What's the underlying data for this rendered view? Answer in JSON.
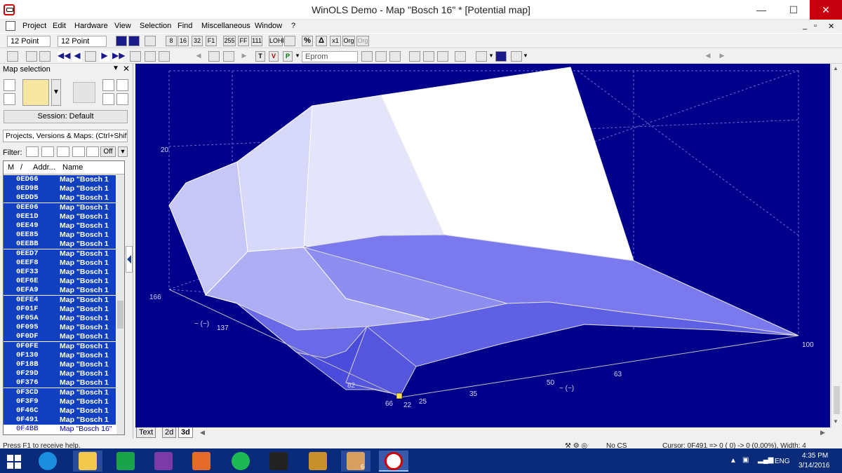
{
  "window": {
    "title": "WinOLS Demo - Map \"Bosch 16\" *   [Potential map]",
    "minimize": "—",
    "maximize": "☐",
    "close": "✕"
  },
  "menu": {
    "items": [
      "Project",
      "Edit",
      "Hardware",
      "View",
      "Selection",
      "Find",
      "Miscellaneous",
      "Window",
      "?"
    ],
    "right_controls": [
      "_",
      "▫",
      "✕"
    ]
  },
  "toolbar1": {
    "font_a": "12 Point",
    "font_b": "12 Point",
    "btn_8": "8",
    "btn_16": "16",
    "btn_32": "32",
    "btn_ff1": "F1",
    "btn_255": "255",
    "btn_ff": "FF",
    "btn_111": "111",
    "btn_lohi": "LOHI",
    "btn_percent": "%",
    "btn_delta": "Δ",
    "btn_x1": "x1",
    "btn_org": "Org",
    "btn_org2": "Org"
  },
  "toolbar2": {
    "eprom": "Eprom",
    "btn_t": "T",
    "btn_v": "V",
    "btn_p": "P"
  },
  "sidebar": {
    "title": "Map selection",
    "session": "Session: Default",
    "combo": "Projects, Versions & Maps:  (Ctrl+Shift+",
    "filter_label": "Filter:",
    "filter_off": "Off",
    "columns": [
      "M",
      "/",
      "Addr...",
      "Name"
    ],
    "rows": [
      {
        "addr": "0ED66",
        "name": "Map \"Bosch 1"
      },
      {
        "addr": "0ED9B",
        "name": "Map \"Bosch 1"
      },
      {
        "addr": "0EDD5",
        "name": "Map \"Bosch 1"
      },
      {
        "addr": "0EE06",
        "name": "Map \"Bosch 1"
      },
      {
        "addr": "0EE1D",
        "name": "Map \"Bosch 1"
      },
      {
        "addr": "0EE49",
        "name": "Map \"Bosch 1"
      },
      {
        "addr": "0EE85",
        "name": "Map \"Bosch 1"
      },
      {
        "addr": "0EEBB",
        "name": "Map \"Bosch 1"
      },
      {
        "addr": "0EED7",
        "name": "Map \"Bosch 1"
      },
      {
        "addr": "0EEF8",
        "name": "Map \"Bosch 1"
      },
      {
        "addr": "0EF33",
        "name": "Map \"Bosch 1"
      },
      {
        "addr": "0EF6E",
        "name": "Map \"Bosch 1"
      },
      {
        "addr": "0EFA9",
        "name": "Map \"Bosch 1"
      },
      {
        "addr": "0EFE4",
        "name": "Map \"Bosch 1"
      },
      {
        "addr": "0F01F",
        "name": "Map \"Bosch 1"
      },
      {
        "addr": "0F05A",
        "name": "Map \"Bosch 1"
      },
      {
        "addr": "0F095",
        "name": "Map \"Bosch 1"
      },
      {
        "addr": "0F0DF",
        "name": "Map \"Bosch 1"
      },
      {
        "addr": "0F0FE",
        "name": "Map \"Bosch 1"
      },
      {
        "addr": "0F130",
        "name": "Map \"Bosch 1"
      },
      {
        "addr": "0F18B",
        "name": "Map \"Bosch 1"
      },
      {
        "addr": "0F29D",
        "name": "Map \"Bosch 1"
      },
      {
        "addr": "0F376",
        "name": "Map \"Bosch 1"
      },
      {
        "addr": "0F3CD",
        "name": "Map \"Bosch 1"
      },
      {
        "addr": "0F3F9",
        "name": "Map \"Bosch 1"
      },
      {
        "addr": "0F46C",
        "name": "Map \"Bosch 1"
      },
      {
        "addr": "0F491",
        "name": "Map \"Bosch 1"
      },
      {
        "addr": "0F4BB",
        "name": "Map \"Bosch 16\""
      }
    ]
  },
  "plot": {
    "z_tick": "20",
    "y_ticks": [
      "166",
      "137",
      "82",
      "66"
    ],
    "y_axis_label": "~ (~)",
    "x_ticks": [
      "22",
      "25",
      "35",
      "50",
      "63",
      "100"
    ],
    "x_axis_label": "~ (~)",
    "colors": {
      "background": "#00008b",
      "surface_light": "#ffffff",
      "surface_dark": "#5a5ae6"
    }
  },
  "view_tabs": [
    "Text",
    "2d",
    "3d"
  ],
  "status": {
    "help": "Press F1 to receive help.",
    "cs": "No CS",
    "cursor": "Cursor: 0F491 =>    0 (  0) ->    0 (0.00%), Width: 4"
  },
  "taskbar": {
    "lang": "ENG",
    "time": "4:35 PM",
    "date": "3/14/2016",
    "badge": "6"
  }
}
